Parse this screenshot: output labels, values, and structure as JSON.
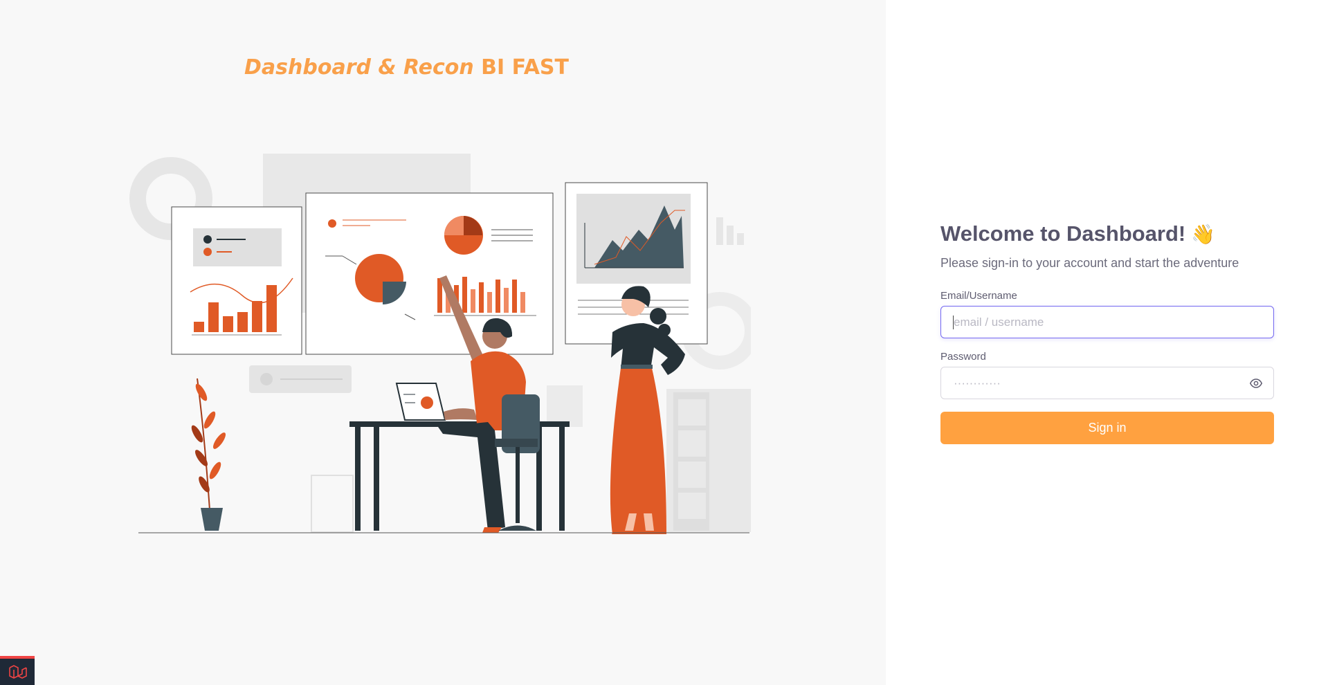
{
  "brand": {
    "title_italic": "Dashboard & Recon",
    "title_rest": "BI FAST"
  },
  "login": {
    "welcome": "Welcome to Dashboard!",
    "welcome_emoji": "👋",
    "subtitle": "Please sign-in to your account and start the adventure",
    "email_label": "Email/Username",
    "email_placeholder": "email / username",
    "password_label": "Password",
    "password_placeholder": "············",
    "password_toggle_icon": "eye-icon",
    "submit_label": "Sign in"
  },
  "illustration": {
    "name": "analytics-team-illustration",
    "accent_color": "#e05a26",
    "dark_color": "#263238"
  },
  "colors": {
    "brand": "#f9a04a",
    "button": "#ffa140",
    "focus_border": "#7367f0",
    "heading": "#56546a"
  },
  "debug_badge": {
    "icon": "laravel-logo-icon"
  }
}
